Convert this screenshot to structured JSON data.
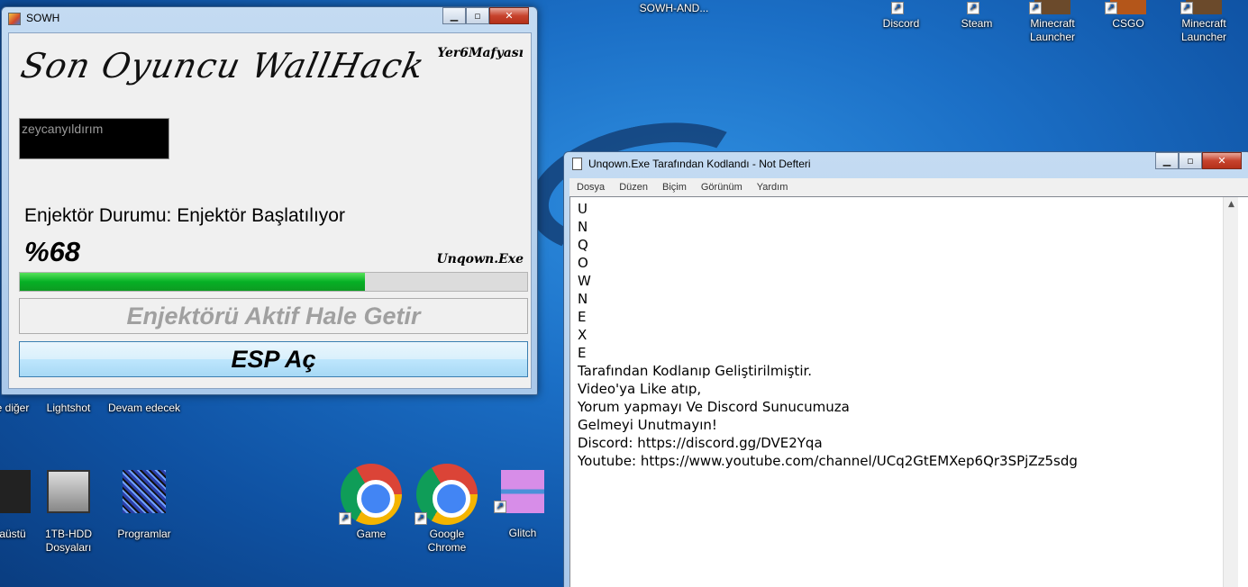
{
  "desktop": {
    "icons_top": [
      {
        "label": "SOWH-AND..."
      },
      {
        "label": "Discord"
      },
      {
        "label": "Steam"
      },
      {
        "label": "Minecraft Launcher"
      },
      {
        "label": "CSGO"
      },
      {
        "label": "Minecraft Launcher"
      }
    ],
    "icons_mid": [
      {
        "label": "e diğer"
      },
      {
        "label": "Lightshot"
      },
      {
        "label": "Devam edecek"
      }
    ],
    "icons_bottom": [
      {
        "label": "aüstü"
      },
      {
        "label": "1TB-HDD Dosyaları"
      },
      {
        "label": "Programlar"
      },
      {
        "label": "Game"
      },
      {
        "label": "Google Chrome"
      },
      {
        "label": "Glitch"
      }
    ]
  },
  "sowh_window": {
    "title": "SOWH",
    "header_script": "Son Oyuncu WallHack",
    "brand_top": "Yer6Mafyası",
    "name_field_value": "zeycanyıldırım",
    "status_text": "Enjektör Durumu: Enjektör Başlatılıyor",
    "percent_text": "%68",
    "progress": 0.68,
    "brand_bottom": "Unqown.Exe",
    "activate_button": "Enjektörü Aktif Hale Getir",
    "esp_button": "ESP Aç",
    "min_label": "▁",
    "max_label": "▫",
    "close_label": "✕"
  },
  "notepad": {
    "title": "Unqown.Exe Tarafından Kodlandı - Not Defteri",
    "menu": [
      "Dosya",
      "Düzen",
      "Biçim",
      "Görünüm",
      "Yardım"
    ],
    "content": "U\nN\nQ\nO\nW\nN\nE\nX\nE\nTarafından Kodlanıp Geliştirilmiştir.\nVideo'ya Like atıp,\nYorum yapmayı Ve Discord Sunucumuza\nGelmeyi Unutmayın!\nDiscord: https://discord.gg/DVE2Yqa\nYoutube: https://www.youtube.com/channel/UCq2GtEMXep6Qr3SPjZz5sdg",
    "min_label": "▁",
    "max_label": "▫",
    "close_label": "✕",
    "scroll_up": "▲"
  },
  "colors": {
    "progress_fill": "#06b025",
    "wallpaper": "#1b6fc6"
  }
}
